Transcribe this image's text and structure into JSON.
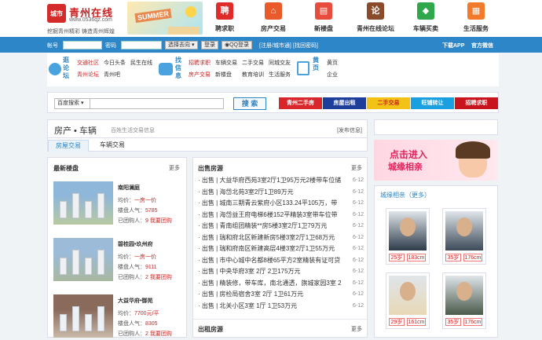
{
  "header": {
    "logo_badge": "城市",
    "logo_name": "青州在线",
    "logo_url": "www.0536qz.com",
    "slogan": "挖掘青州精彩 铸造青州辉煌",
    "banner_text": "SUMMER",
    "nav": [
      {
        "label": "聘求职",
        "glyph": "聘",
        "color": "#e02b2b"
      },
      {
        "label": "房产交易",
        "glyph": "⌂",
        "color": "#ea5a2a"
      },
      {
        "label": "新楼盘",
        "glyph": "▤",
        "color": "#e84c3d"
      },
      {
        "label": "青州在线论坛",
        "glyph": "论",
        "color": "#8a4b2a"
      },
      {
        "label": "车辆买卖",
        "glyph": "◆",
        "color": "#2ea84a"
      },
      {
        "label": "生活服务",
        "glyph": "▦",
        "color": "#f27a2a"
      }
    ]
  },
  "login": {
    "account_label": "帐号",
    "password_label": "密码",
    "select_default": "选择去向",
    "login_btn": "登录",
    "qq_btn": "QQ登录",
    "register": "[注册/城市通]",
    "forgot": "[找回密码]",
    "download": "下载APP",
    "wechat": "官方微信"
  },
  "subnav": {
    "s1_icon": "逛论坛",
    "s1_links": [
      "交通社区",
      "今日头条",
      "民生在线",
      "青州论坛",
      "青州吧"
    ],
    "s2_icon": "找信息",
    "s2_links": [
      "招聘求职",
      "车辆交易",
      "二手交易",
      "同城交友",
      "房产交易",
      "新楼盘",
      "教育培训",
      "生活服务"
    ],
    "s3_icon": "黄页",
    "s3_links": [
      "黄页",
      "企业"
    ]
  },
  "search": {
    "select": "百度搜索",
    "btn": "搜 索",
    "tags": [
      {
        "label": "青州二手房",
        "color": "#d9262b"
      },
      {
        "label": "房屋出租",
        "color": "#1e3e9c"
      },
      {
        "label": "二手交易",
        "color": "#f2c316"
      },
      {
        "label": "旺铺转让",
        "color": "#1a9fe0"
      },
      {
        "label": "招聘求职",
        "color": "#c8141d"
      }
    ]
  },
  "section": {
    "title": "房产 • 车辆",
    "subtitle": "百姓生活交易信息",
    "publish": "[发布信息]",
    "tabs": [
      "房屋交易",
      "车辆交易"
    ]
  },
  "buildings": {
    "title": "最新楼盘",
    "more": "更多",
    "items": [
      {
        "name": "南阳澜庭",
        "price": "一房一价",
        "popularity": "5785",
        "group": "9 我要团购",
        "avg_label": "均价：",
        "pop_label": "楼盘人气：",
        "grp_label": "已团购人："
      },
      {
        "name": "碧桂园•玖州府",
        "price": "一房一价",
        "popularity": "9111",
        "group": "2 我要团购",
        "avg_label": "均价：",
        "pop_label": "楼盘人气：",
        "grp_label": "已团购人："
      },
      {
        "name": "大益华府•御苑",
        "price": "7700元/平",
        "popularity": "8305",
        "group": "2 我要团购",
        "avg_label": "均价：",
        "pop_label": "楼盘人气：",
        "grp_label": "已团购人："
      }
    ]
  },
  "sale": {
    "title": "出售房源",
    "more": "更多",
    "items": [
      {
        "text": "· 出售 | 大益华府西苑3室2厅1卫95万元2楼带车位储",
        "date": "6-12"
      },
      {
        "text": "· 出售 | 海岱北苑3室2厅1卫89万元",
        "date": "6-12"
      },
      {
        "text": "· 出售 | 城南三期青云紫府小区133.24平105万，带",
        "date": "6-12"
      },
      {
        "text": "· 出售 | 海岱益王府电梯6楼152平精装3室带车位带",
        "date": "6-12"
      },
      {
        "text": "· 出售 | 青南组团精装**房5楼3室2厅1卫79万元",
        "date": "6-12"
      },
      {
        "text": "· 出售 | 瑞和府北区新建新房5楼3室2厅1卫68万元",
        "date": "6-12"
      },
      {
        "text": "· 出售 | 瑞和府南区新建高层4楼3室2厅1卫55万元",
        "date": "6-12"
      },
      {
        "text": "· 出售 | 市中心城中名都8楼65平方2室精装有证可贷",
        "date": "6-12"
      },
      {
        "text": "· 出售 | 中央华府3室 2厅 2卫175万元",
        "date": "6-12"
      },
      {
        "text": "· 出售 | 精装修，带车库，南北通透，旗城家园3室 2",
        "date": "6-12"
      },
      {
        "text": "· 出售 | 房检局宿舍3室 2厅 1卫61万元",
        "date": "6-12"
      },
      {
        "text": "· 出售 | 北关小区3室 1厅 1卫53万元",
        "date": "6-12"
      }
    ]
  },
  "rent": {
    "title": "出租房源",
    "more": "更多"
  },
  "promo": {
    "line1": "点击进入",
    "line2": "城缘相亲"
  },
  "dating": {
    "title": "城缘相亲（更多）",
    "cards": [
      {
        "age": "25岁",
        "height": "183cm"
      },
      {
        "age": "35岁",
        "height": "176cm"
      },
      {
        "age": "29岁",
        "height": "161cm"
      },
      {
        "age": "35岁",
        "height": "176cm"
      }
    ]
  }
}
